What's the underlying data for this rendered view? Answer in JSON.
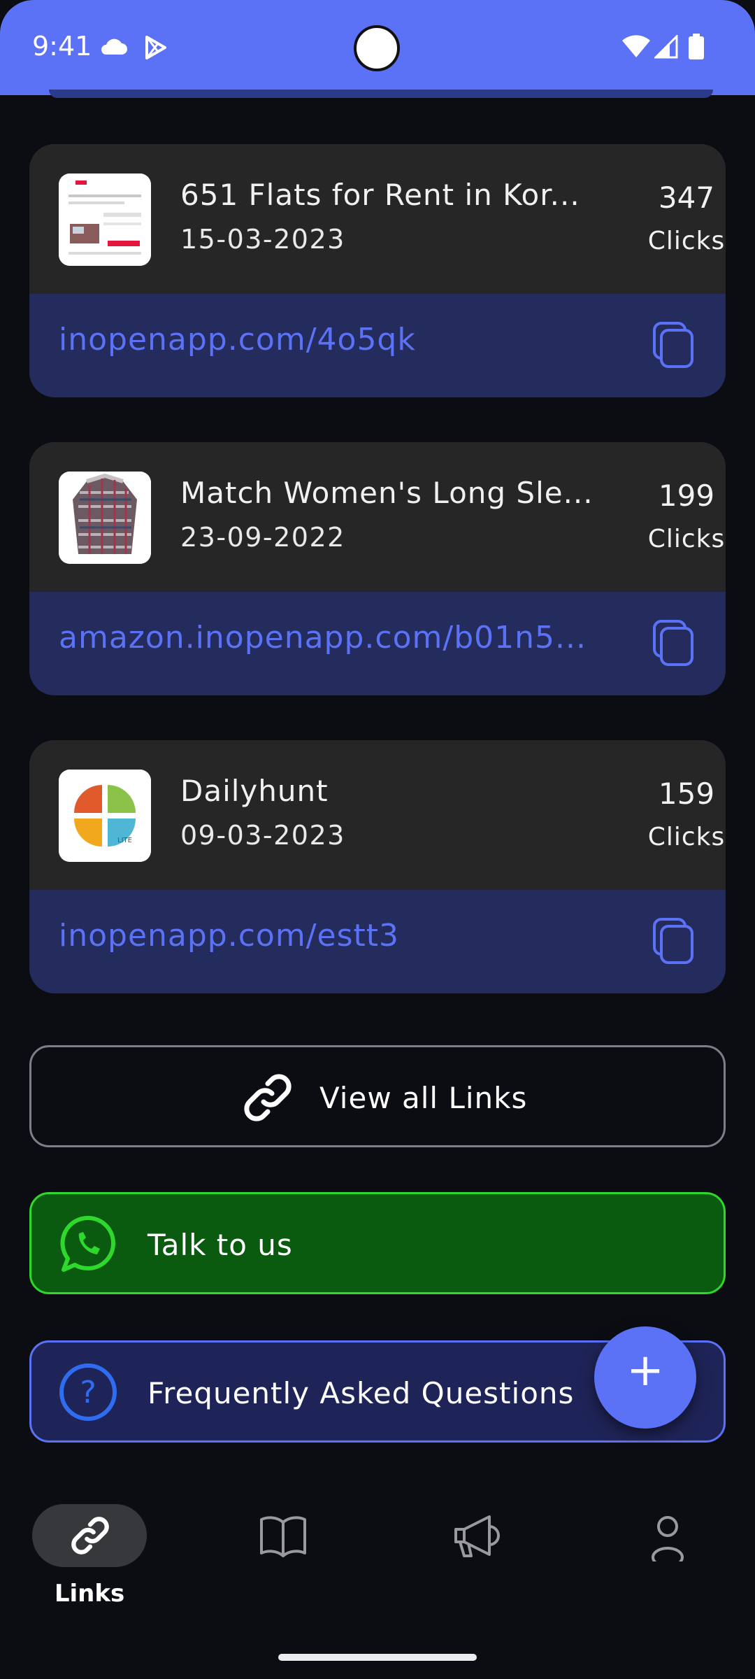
{
  "status_bar": {
    "time": "9:41",
    "icons": [
      "cloud-icon",
      "play-store-icon",
      "wifi-icon",
      "signal-icon",
      "battery-icon"
    ]
  },
  "links": [
    {
      "title": "651   Flats for Rent in Kor...",
      "date": "15-03-2023",
      "clicks_count": "347",
      "clicks_label": "Clicks",
      "url": "inopenapp.com/4o5qk",
      "thumbnail": "website-thumbnail"
    },
    {
      "title": "Match Women's Long Sle...",
      "date": "23-09-2022",
      "clicks_count": "199",
      "clicks_label": "Clicks",
      "url": "amazon.inopenapp.com/b01n5...",
      "thumbnail": "shirt-thumbnail"
    },
    {
      "title": "Dailyhunt",
      "date": "09-03-2023",
      "clicks_count": "159",
      "clicks_label": "Clicks",
      "url": "inopenapp.com/estt3",
      "thumbnail": "dailyhunt-logo"
    }
  ],
  "actions": {
    "view_all": "View all Links",
    "talk": "Talk to us",
    "faq": "Frequently Asked Questions",
    "fab": "+"
  },
  "bottom_nav": {
    "items": [
      {
        "label": "Links",
        "icon": "link-icon",
        "active": true
      },
      {
        "label": "",
        "icon": "book-icon",
        "active": false
      },
      {
        "label": "",
        "icon": "megaphone-icon",
        "active": false
      },
      {
        "label": "",
        "icon": "profile-icon",
        "active": false
      }
    ]
  },
  "colors": {
    "accent": "#5b72f7",
    "background": "#0b0d12",
    "card": "#262627",
    "url_bar": "#232c5d",
    "whatsapp_green": "#2fd82c"
  }
}
